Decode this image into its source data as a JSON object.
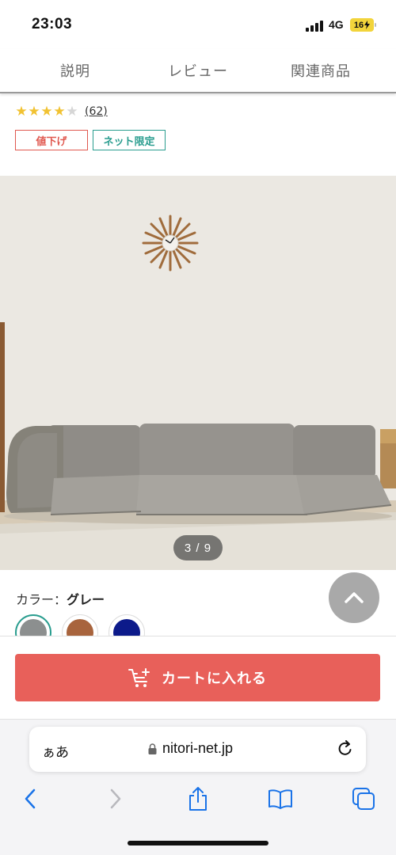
{
  "status": {
    "time": "23:03",
    "network": "4G",
    "battery": "16"
  },
  "tabs": [
    {
      "label": "説明"
    },
    {
      "label": "レビュー"
    },
    {
      "label": "関連商品"
    }
  ],
  "rating": {
    "stars": 4,
    "max": 5,
    "count": "(62)"
  },
  "badges": {
    "sale": "値下げ",
    "online": "ネット限定"
  },
  "image": {
    "counter": "3 / 9",
    "alt": "sofa"
  },
  "color": {
    "label": "カラー：",
    "value": "グレー",
    "swatches": [
      {
        "name": "gray",
        "hex": "#8c8f8f",
        "selected": true
      },
      {
        "name": "brown",
        "hex": "#a8643d",
        "selected": false
      },
      {
        "name": "navy",
        "hex": "#0c1a8a",
        "selected": false
      }
    ]
  },
  "cart": {
    "label": "カートに入れる",
    "color": "#e8605a"
  },
  "browser": {
    "aa_label": "ぁあ",
    "url": "nitori-net.jp"
  },
  "icons": {
    "scroll_top": "chevron-up-icon",
    "cart": "cart-add-icon",
    "back": "chevron-left-icon",
    "forward": "chevron-right-icon",
    "share": "share-icon",
    "bookmarks": "book-icon",
    "tabs": "tabs-icon",
    "lock": "lock-icon",
    "reload": "reload-icon"
  },
  "colors": {
    "accent_teal": "#2a9d8f",
    "sale_red": "#e0584f",
    "link_blue": "#1a73e8"
  }
}
